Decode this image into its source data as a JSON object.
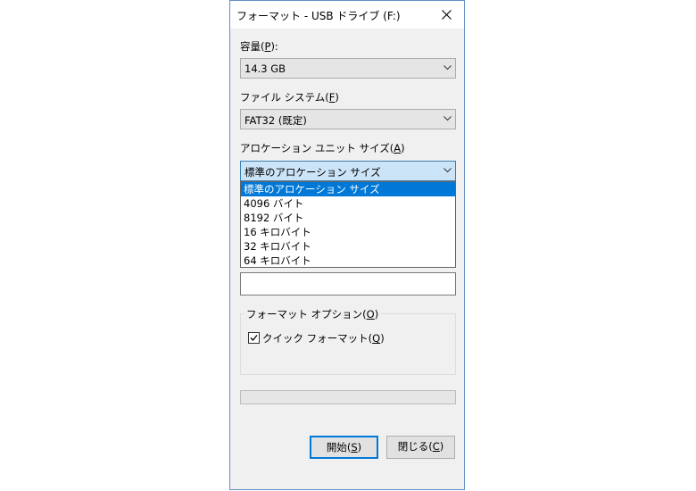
{
  "window": {
    "title": "フォーマット - USB ドライブ (F:)"
  },
  "capacity": {
    "label_pre": "容量(",
    "label_key": "P",
    "label_post": "):",
    "value": "14.3 GB"
  },
  "filesystem": {
    "label_pre": "ファイル システム(",
    "label_key": "F",
    "label_post": ")",
    "value": "FAT32 (既定)"
  },
  "allocation": {
    "label_pre": "アロケーション ユニット サイズ(",
    "label_key": "A",
    "label_post": ")",
    "value": "標準のアロケーション サイズ",
    "options": [
      "標準のアロケーション サイズ",
      "4096 バイト",
      "8192 バイト",
      "16 キロバイト",
      "32 キロバイト",
      "64 キロバイト"
    ],
    "selected_index": 0
  },
  "volume_label": {
    "value": ""
  },
  "format_options": {
    "title_pre": "フォーマット オプション(",
    "title_key": "O",
    "title_post": ")",
    "quick_pre": "クイック フォーマット(",
    "quick_key": "Q",
    "quick_post": ")",
    "quick_checked": true
  },
  "progress": {
    "fraction": 0
  },
  "buttons": {
    "start_pre": "開始(",
    "start_key": "S",
    "start_post": ")",
    "close_pre": "閉じる(",
    "close_key": "C",
    "close_post": ")"
  },
  "icons": {
    "close": "close-icon",
    "chevron": "chevron-down-icon",
    "check": "checkmark-icon"
  }
}
